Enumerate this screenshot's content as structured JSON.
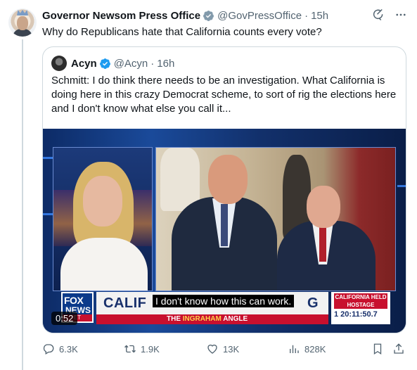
{
  "tweet": {
    "author_name": "Governor Newsom Press Office",
    "handle": "@GovPressOffice",
    "separator": "·",
    "time": "15h",
    "text": "Why do Republicans hate that California counts every vote?"
  },
  "quote": {
    "author_name": "Acyn",
    "handle": "@Acyn",
    "separator": "·",
    "time": "16h",
    "text": "Schmitt:  I do think there needs to be an investigation. What California is doing here in this crazy Democrat scheme, to sort of rig the elections here and I don't know what else you call it..."
  },
  "video": {
    "caption": "I don't know how this can work.",
    "duration": "0:52",
    "chyron": {
      "logo_top": "FOX",
      "logo_bottom": "NEWS",
      "logo_tag": "ET",
      "headline": "CALIF",
      "headline_tail": "G",
      "show_prefix": "THE",
      "show_name": "INGRAHAM",
      "show_suffix": "ANGLE",
      "side_title": "CALIFORNIA HELD HOSTAGE",
      "side_clock": "1  20:11:50.7"
    }
  },
  "actions": {
    "replies": "6.3K",
    "retweets": "1.9K",
    "likes": "13K",
    "views": "828K"
  },
  "colors": {
    "verified_blue": "#1d9bf0",
    "muted_text": "#536471",
    "fox_red": "#c8102e",
    "fox_blue": "#0b3a8a"
  },
  "icons": [
    "verified-badge-icon",
    "grok-icon",
    "more-icon",
    "reply-icon",
    "retweet-icon",
    "like-icon",
    "views-icon",
    "bookmark-icon",
    "share-icon"
  ]
}
